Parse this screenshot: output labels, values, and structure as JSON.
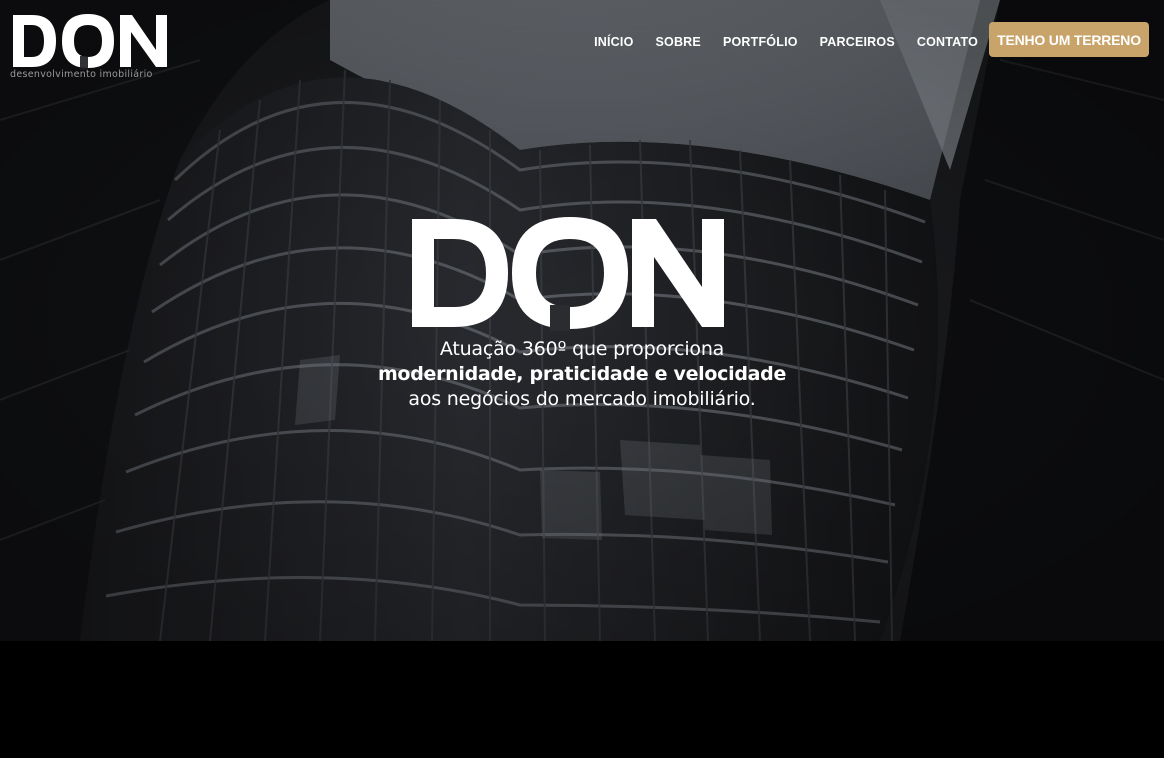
{
  "brand": {
    "name": "DON",
    "tagline": "desenvolvimento imobiliário"
  },
  "nav": {
    "items": [
      {
        "label": "INÍCIO"
      },
      {
        "label": "SOBRE"
      },
      {
        "label": "PORTFÓLIO"
      },
      {
        "label": "PARCEIROS"
      },
      {
        "label": "CONTATO"
      }
    ],
    "cta_label": "TENHO UM TERRENO"
  },
  "hero": {
    "logo_text": "DON",
    "line1": "Atuação 360º que proporciona",
    "line2": "modernidade, praticidade e velocidade",
    "line3": "aos negócios do mercado imobiliário."
  },
  "colors": {
    "accent": "#c9a46a",
    "text": "#ffffff",
    "background": "#000000"
  },
  "icons": {
    "logo": "don-logo-icon"
  }
}
